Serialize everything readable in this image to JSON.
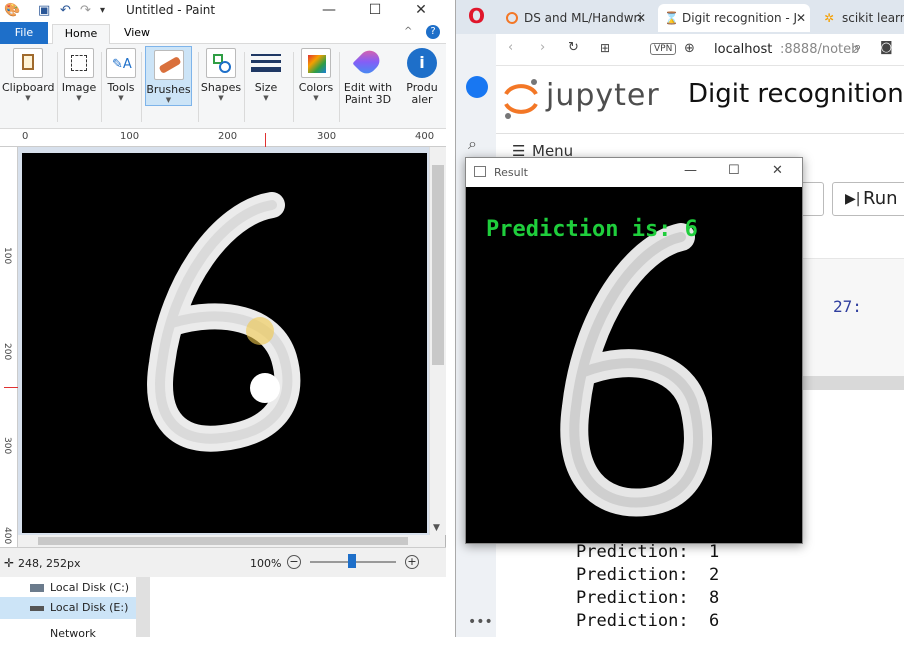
{
  "paint": {
    "title": "Untitled - Paint",
    "tabs": {
      "file": "File",
      "home": "Home",
      "view": "View"
    },
    "groups": {
      "clipboard": "Clipboard",
      "image": "Image",
      "tools": "Tools",
      "brushes": "Brushes",
      "shapes": "Shapes",
      "size": "Size",
      "colors": "Colors",
      "edit3d_line1": "Edit with",
      "edit3d_line2": "Paint 3D",
      "product_line1": "Produ",
      "product_line2": "aler"
    },
    "ruler_ticks": [
      "0",
      "100",
      "200",
      "300",
      "400"
    ],
    "ruler_side_ticks": [
      "100",
      "200",
      "300",
      "400"
    ],
    "cursor_pos": "248, 252px",
    "zoom": "100%",
    "drives": [
      "Local Disk (C:)",
      "Local Disk (E:)"
    ],
    "network": "Network",
    "brush_color": "#ffffff",
    "canvas_color": "#000000"
  },
  "browser": {
    "tabs": [
      {
        "label": "DS and ML/Handwri",
        "icon": "jupyter-icon"
      },
      {
        "label": "Digit recognition - J",
        "icon": "hourglass-icon"
      },
      {
        "label": "scikit learn -",
        "icon": "sklearn-icon"
      }
    ],
    "vpn": "VPN",
    "url_host": "localhost",
    "url_rest": ":8888/noteb",
    "jupyter_word": "jupyter",
    "notebook_title": "Digit recognition",
    "menu_label": "Menu",
    "run_label": "Run",
    "cell_prompt_fragment": "27:",
    "predictions": [
      "Prediction:  1",
      "Prediction:  2",
      "Prediction:  8",
      "Prediction:  6"
    ],
    "accent": "#f37726"
  },
  "result": {
    "title": "Result",
    "prediction_text": "Prediction is: 6",
    "prediction_color": "#1fce3c"
  }
}
